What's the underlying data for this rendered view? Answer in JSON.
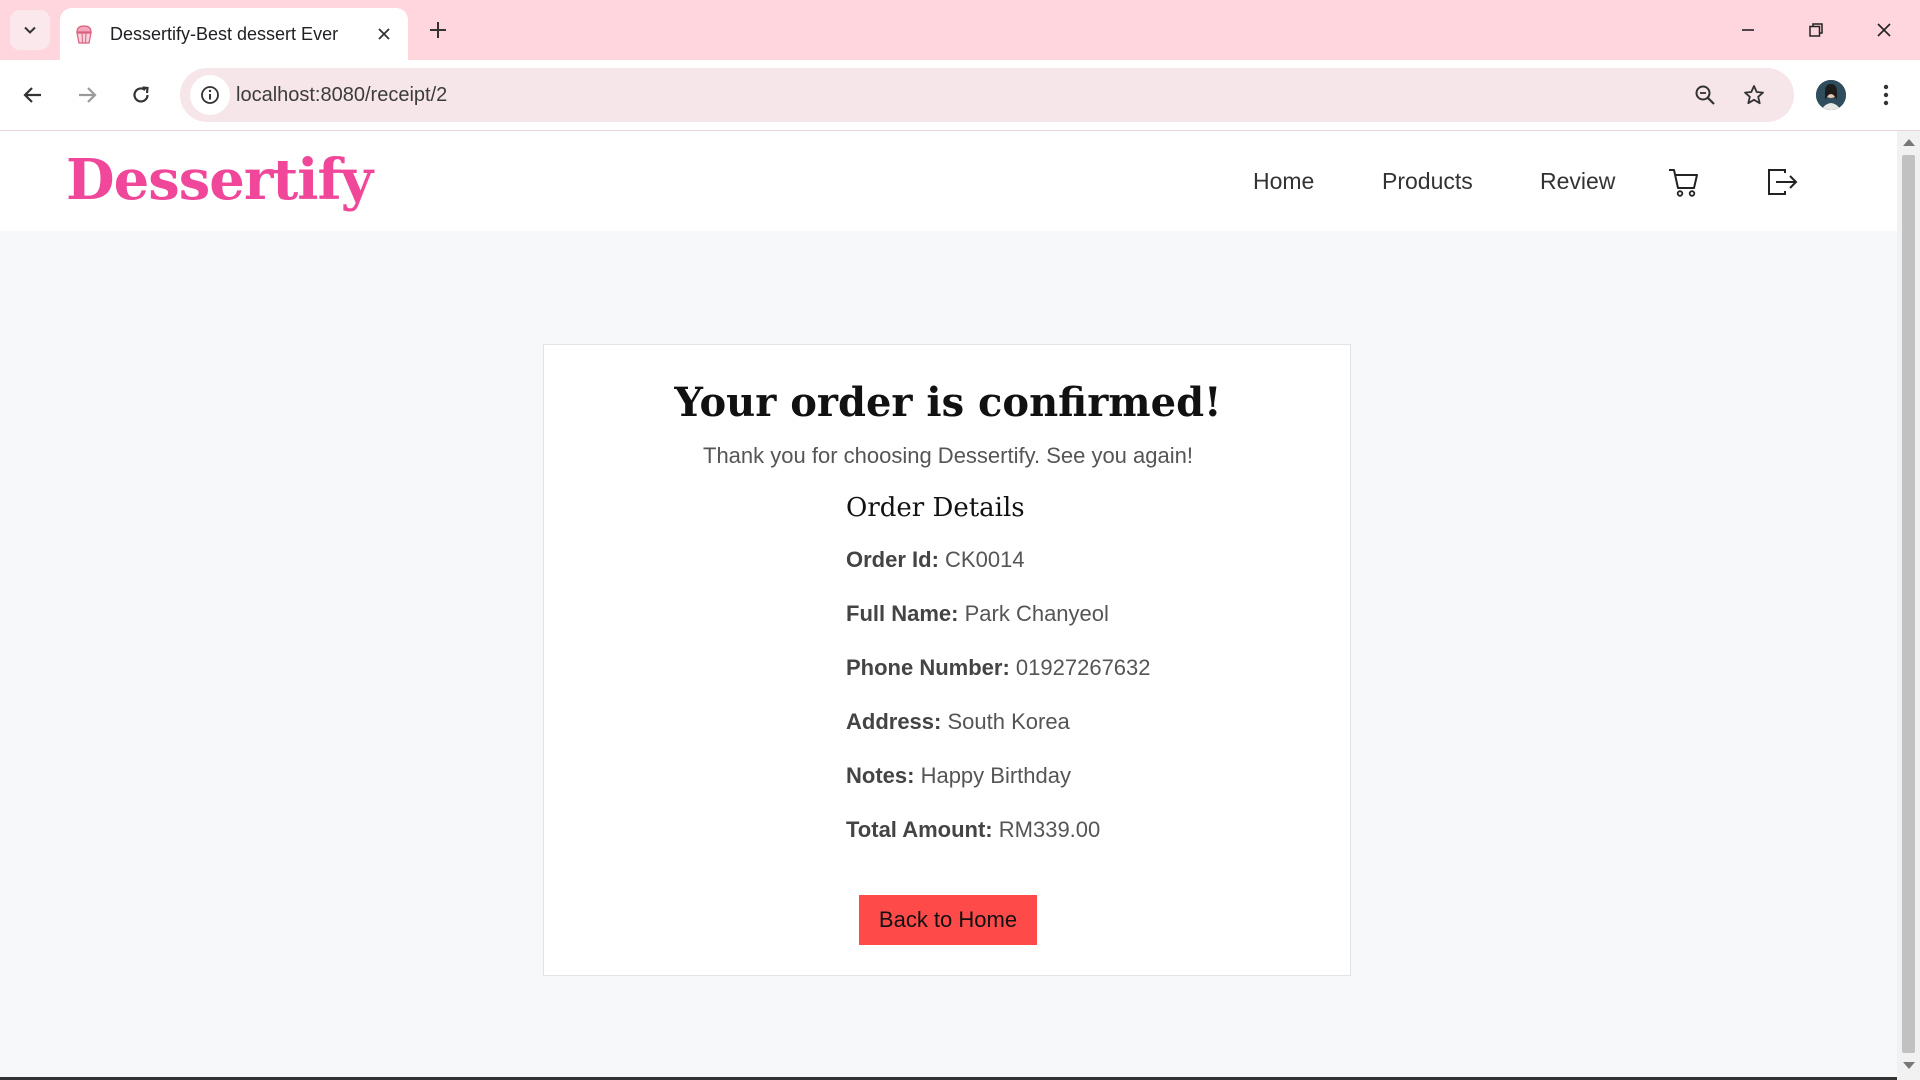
{
  "browser": {
    "tab_title": "Dessertify-Best dessert Ever",
    "url": "localhost:8080/receipt/2",
    "tab_icon": "cupcake-icon",
    "colors": {
      "tabstrip": "#ffd6de",
      "omnibox": "#f6e5e9"
    }
  },
  "site": {
    "logo": "Dessertify",
    "nav": [
      {
        "label": "Home"
      },
      {
        "label": "Products"
      },
      {
        "label": "Review"
      }
    ],
    "icons": [
      "cart-icon",
      "logout-icon"
    ],
    "colors": {
      "brand": "#f0479a",
      "button": "#ff4a4a"
    }
  },
  "receipt": {
    "title": "Your order is confirmed!",
    "subtitle": "Thank you for choosing Dessertify. See you again!",
    "details_title": "Order Details",
    "fields": [
      {
        "label": "Order Id:",
        "value": "CK0014"
      },
      {
        "label": "Full Name:",
        "value": "Park Chanyeol"
      },
      {
        "label": "Phone Number:",
        "value": "01927267632"
      },
      {
        "label": "Address:",
        "value": "South Korea"
      },
      {
        "label": "Notes:",
        "value": "Happy Birthday"
      },
      {
        "label": "Total Amount:",
        "value": "RM339.00"
      }
    ],
    "back_button": "Back to Home"
  }
}
